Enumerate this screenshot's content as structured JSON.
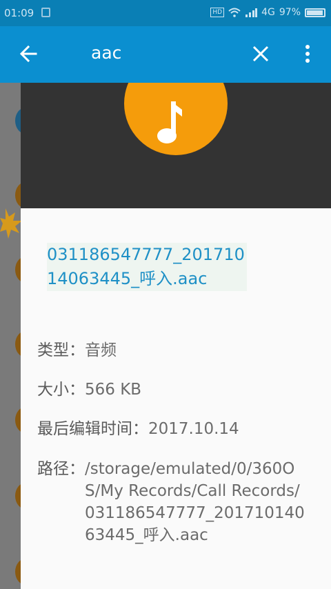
{
  "status_bar": {
    "time": "01:09",
    "hd_badge": "HD",
    "network": "4G",
    "battery": "97%"
  },
  "toolbar": {
    "query": "aac"
  },
  "details": {
    "filename": "031186547777_20171014063445_呼入.aac",
    "type_label": "类型：",
    "type_value": "音频",
    "size_label": "大小：",
    "size_value": "566 KB",
    "modified_label": "最后编辑时间：",
    "modified_value": "2017.10.14",
    "path_label": "路径：",
    "path_value": "/storage/emulated/0/360OS/My Records/Call Records/031186547777_20171014063445_呼入.aac"
  },
  "colors": {
    "toolbar": "#0b8fd0",
    "status_bar": "#0a7fb5",
    "accent_orange": "#f59c0b",
    "filename_blue": "#1e90c6"
  }
}
